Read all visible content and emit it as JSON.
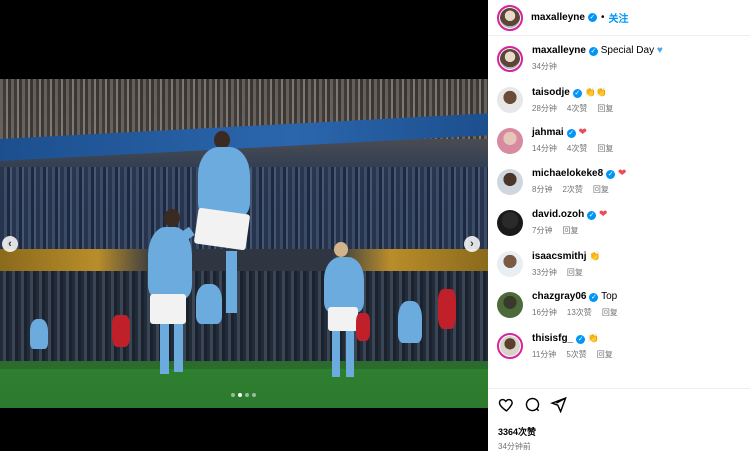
{
  "post": {
    "author": "maxalleyne",
    "follow_sep": "•",
    "follow_label": "关注",
    "caption": "Special Day",
    "caption_time": "34分钟",
    "likes": "3364次赞",
    "posted_ago": "34分钟前"
  },
  "comments": [
    {
      "user": "taisodje",
      "text": "",
      "emoji": "👏👏",
      "time": "28分钟",
      "likes": "4次赞",
      "reply": "回复"
    },
    {
      "user": "jahmai",
      "text": "",
      "emoji": "❤",
      "time": "14分钟",
      "likes": "4次赞",
      "reply": "回复"
    },
    {
      "user": "michaelokeke8",
      "text": "",
      "emoji": "❤",
      "time": "8分钟",
      "likes": "2次赞",
      "reply": "回复"
    },
    {
      "user": "david.ozoh",
      "text": "",
      "emoji": "❤",
      "time": "7分钟",
      "likes": "",
      "reply": "回复"
    },
    {
      "user": "isaacsmithj",
      "text": "",
      "emoji": "👏",
      "time": "33分钟",
      "likes": "",
      "reply": "回复"
    },
    {
      "user": "chazgray06",
      "text": "Top",
      "emoji": "",
      "time": "16分钟",
      "likes": "13次赞",
      "reply": "回复"
    },
    {
      "user": "thisisfg_",
      "text": "",
      "emoji": "👏",
      "time": "11分钟",
      "likes": "5次赞",
      "reply": "回复"
    }
  ],
  "carousel": {
    "prev": "‹",
    "next": "›"
  },
  "icons": [
    "heart-icon",
    "comment-icon",
    "share-icon"
  ],
  "colors": {
    "link": "#0095f6",
    "verified": "#0095f6",
    "heart": "#ed4956",
    "muted": "#737373"
  }
}
